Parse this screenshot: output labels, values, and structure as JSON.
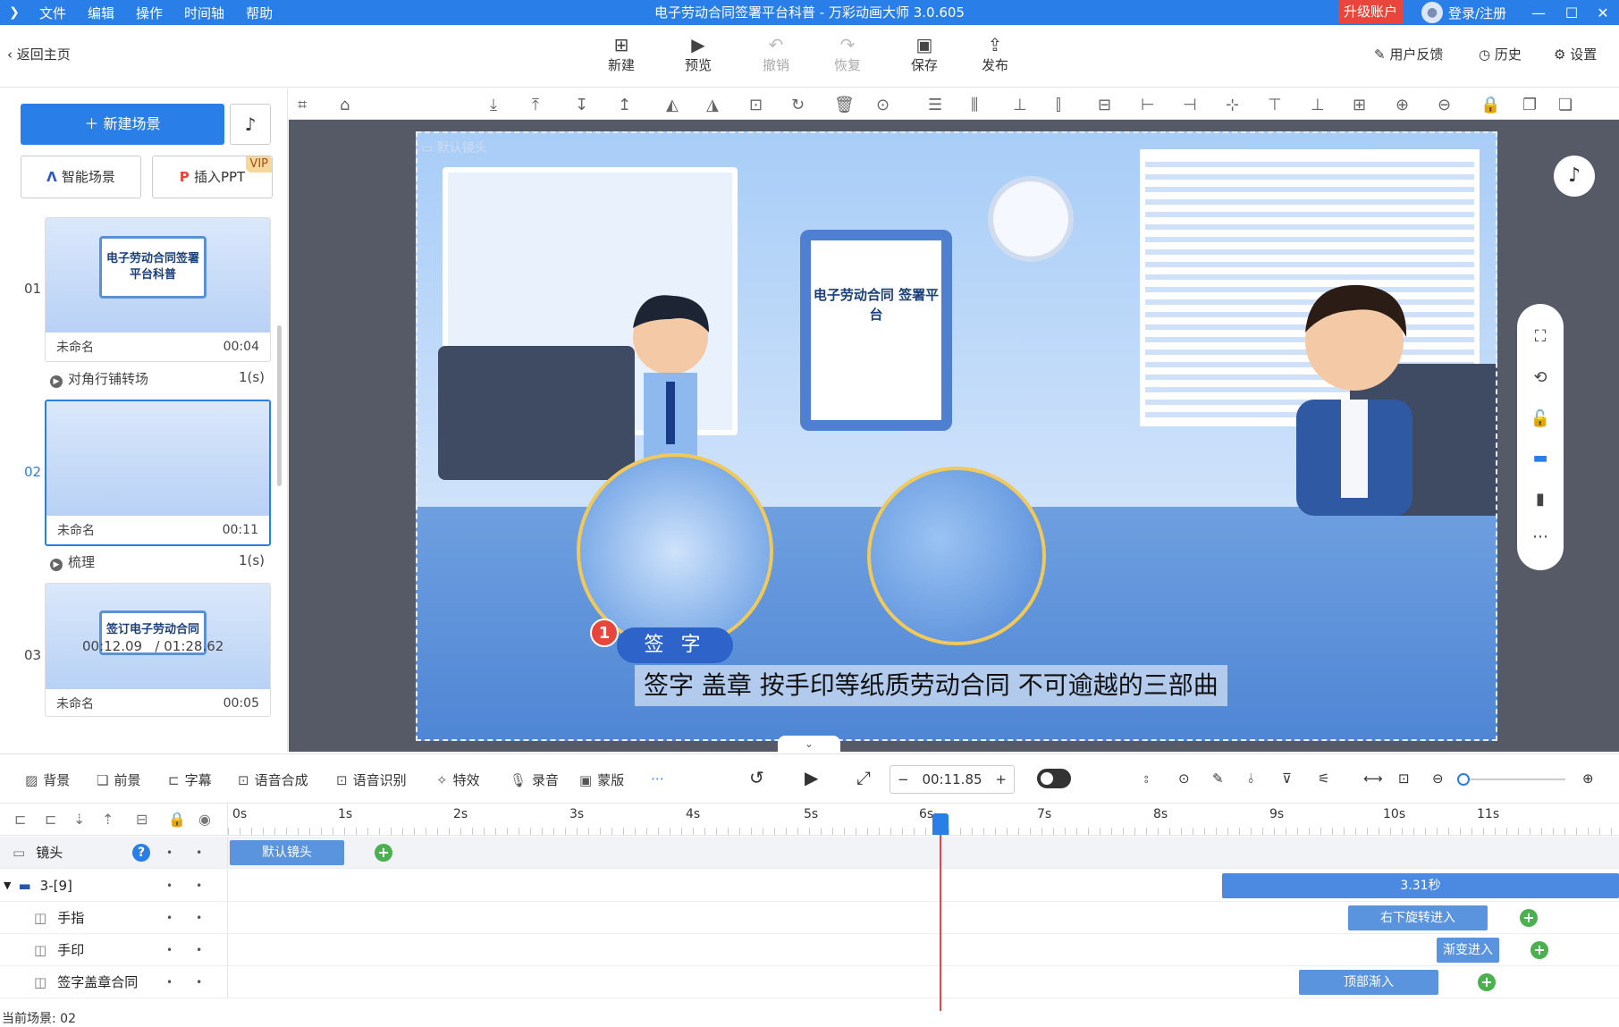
{
  "app": {
    "title": "电子劳动合同签署平台科普 - 万彩动画大师 3.0.605",
    "menu": [
      "文件",
      "编辑",
      "操作",
      "时间轴",
      "帮助"
    ],
    "upgrade": "升级账户",
    "login": "登录/注册"
  },
  "toolbar": {
    "back": "返回主页",
    "new": "新建",
    "preview": "预览",
    "undo": "撤销",
    "redo": "恢复",
    "save": "保存",
    "publish": "发布",
    "feedback": "用户反馈",
    "history": "历史",
    "settings": "设置"
  },
  "left": {
    "new_scene": "新建场景",
    "smart_scene": "智能场景",
    "insert_ppt": "插入PPT",
    "vip": "VIP",
    "scenes": [
      {
        "num": "01",
        "name": "未命名",
        "duration": "00:04",
        "thumb_text": "电子劳动合同签署平台科普"
      },
      {
        "num": "02",
        "name": "未命名",
        "duration": "00:11",
        "thumb_text": ""
      },
      {
        "num": "03",
        "name": "未命名",
        "duration": "00:05",
        "thumb_text": "签订电子劳动合同"
      }
    ],
    "transitions": [
      {
        "name": "对角行铺转场",
        "dur": "1(s)"
      },
      {
        "name": "梳理",
        "dur": "1(s)"
      }
    ],
    "current_time": "00:12.09",
    "total_time": "/ 01:28.62"
  },
  "canvas": {
    "camera_label": "默认镜头",
    "tablet_text": "电子劳动合同 签署平台",
    "badge_num": "1",
    "sign_tag": "签 字",
    "subtitle": "签字 盖章 按手印等纸质劳动合同 不可逾越的三部曲"
  },
  "tools": {
    "bg": "背景",
    "fg": "前景",
    "caption": "字幕",
    "tts": "语音合成",
    "asr": "语音识别",
    "fx": "特效",
    "record": "录音",
    "mask": "蒙版",
    "time": "00:11.85",
    "minus": "−",
    "plus": "+"
  },
  "timeline": {
    "ticks": [
      "0s",
      "1s",
      "2s",
      "3s",
      "4s",
      "5s",
      "6s",
      "7s",
      "8s",
      "9s",
      "10s",
      "11s"
    ],
    "tracks": [
      {
        "name": "镜头",
        "clip": "默认镜头"
      },
      {
        "name": "3-[9]",
        "clip": "3.31秒"
      },
      {
        "name": "手指",
        "clip": "右下旋转进入"
      },
      {
        "name": "手印",
        "clip": "渐变进入"
      },
      {
        "name": "签字盖章合同",
        "clip": "顶部渐入"
      }
    ],
    "current_scene": "当前场景: 02"
  },
  "colors": {
    "accent": "#2a7ee8",
    "danger": "#e8453c",
    "keyframe": "#4caf50"
  }
}
